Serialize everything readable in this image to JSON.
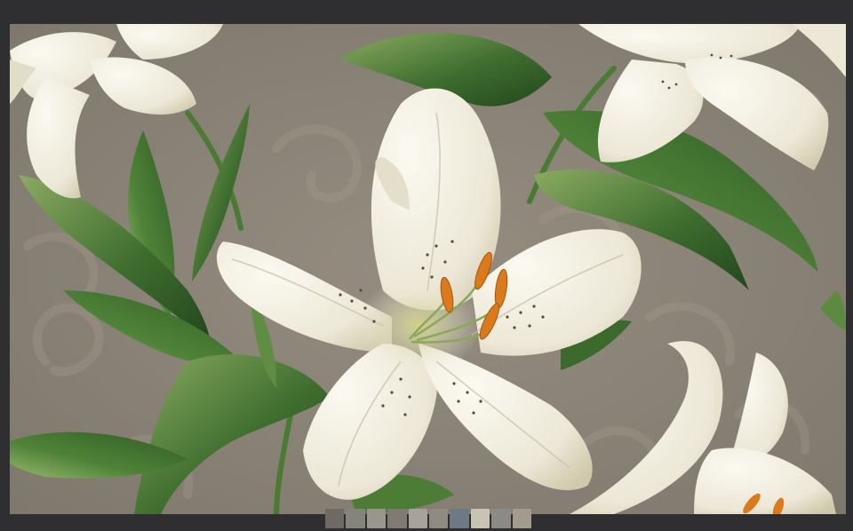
{
  "viewer": {
    "background": "#2f2f31",
    "image": {
      "subject": "painting-white-lilies",
      "colors": {
        "background_wallpaper": "#8e867a",
        "wallpaper_swirl": "#9b9385",
        "petal_white": "#f3f0e6",
        "petal_shadow": "#d9d4bf",
        "leaf_green": "#3f6e2f",
        "leaf_light": "#7ea05a",
        "anther_orange": "#d97a1c",
        "speckle": "#5a4a38"
      }
    },
    "thumbnail_strip": {
      "thumbnails": [
        {
          "color": "#6e6a63"
        },
        {
          "color": "#86837c"
        },
        {
          "color": "#9a958d"
        },
        {
          "color": "#7f7b74"
        },
        {
          "color": "#a8a39a"
        },
        {
          "color": "#8f8a82"
        },
        {
          "color": "#6d7a86"
        },
        {
          "color": "#c9c3b4"
        },
        {
          "color": "#8b8a86"
        },
        {
          "color": "#a39c8c"
        }
      ]
    }
  }
}
